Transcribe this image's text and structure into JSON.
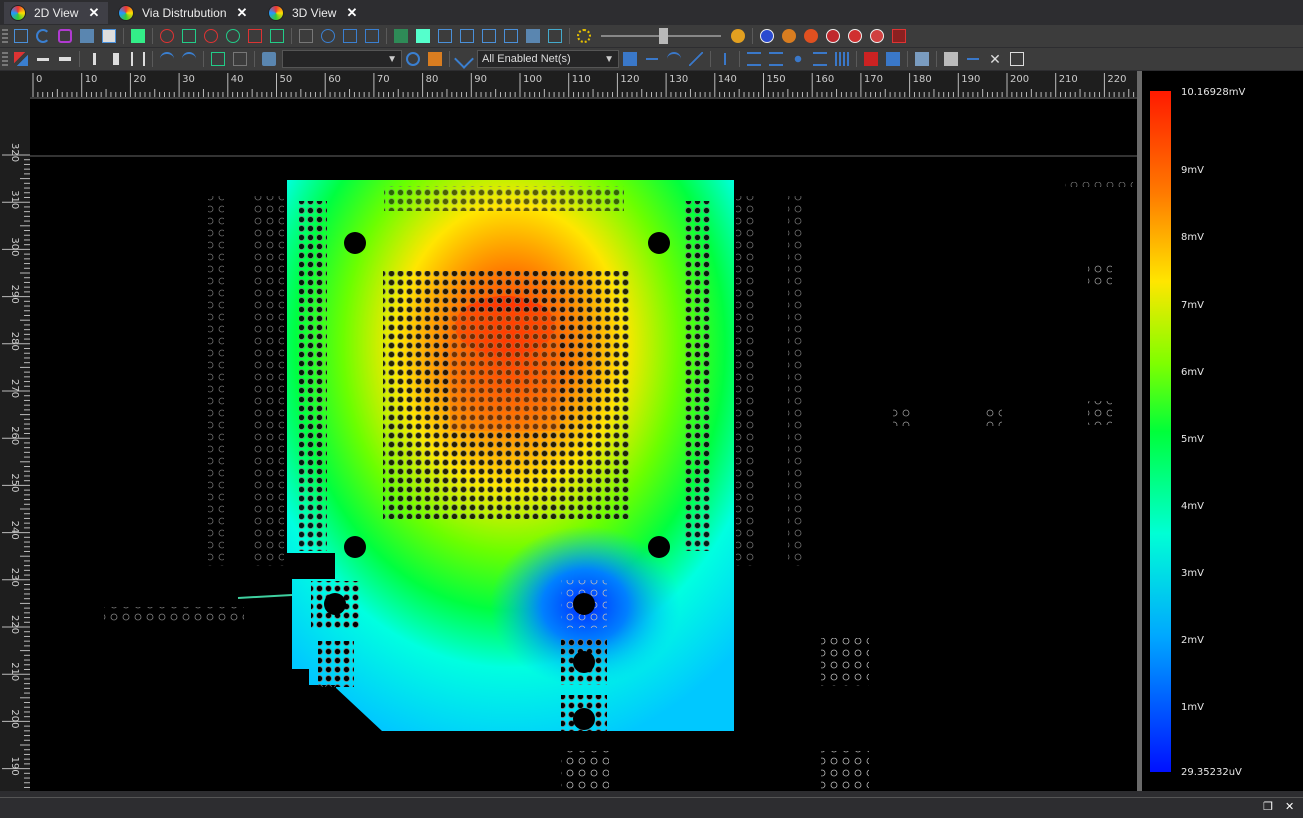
{
  "tabs": [
    {
      "label": "2D View",
      "close": "✕"
    },
    {
      "label": "Via Distrubution",
      "close": "✕"
    },
    {
      "label": "3D View",
      "close": "✕"
    }
  ],
  "toolbar": {
    "layer_combo_value": "",
    "net_combo_value": "All Enabled Net(s)"
  },
  "ruler": {
    "x_ticks": [
      "0",
      "10",
      "20",
      "30",
      "40",
      "50",
      "60",
      "70",
      "80",
      "90",
      "100",
      "110",
      "120",
      "130",
      "140",
      "150",
      "160",
      "170",
      "180",
      "190",
      "200",
      "210",
      "220"
    ],
    "y_ticks": [
      "320",
      "310",
      "300",
      "290",
      "280",
      "270",
      "260",
      "250",
      "240",
      "230",
      "220",
      "210",
      "200",
      "190"
    ]
  },
  "legend": {
    "max_label": "10.16928mV",
    "min_label": "29.35232uV",
    "ticks": [
      "9mV",
      "8mV",
      "7mV",
      "6mV",
      "5mV",
      "4mV",
      "3mV",
      "2mV",
      "1mV"
    ]
  },
  "colors": {
    "background": "#000000",
    "ui_dark": "#2d2d30",
    "toolbar": "#3c3c3c",
    "ruler": "#2b2b2b"
  },
  "status": {
    "restore": "❐",
    "close": "✕"
  }
}
